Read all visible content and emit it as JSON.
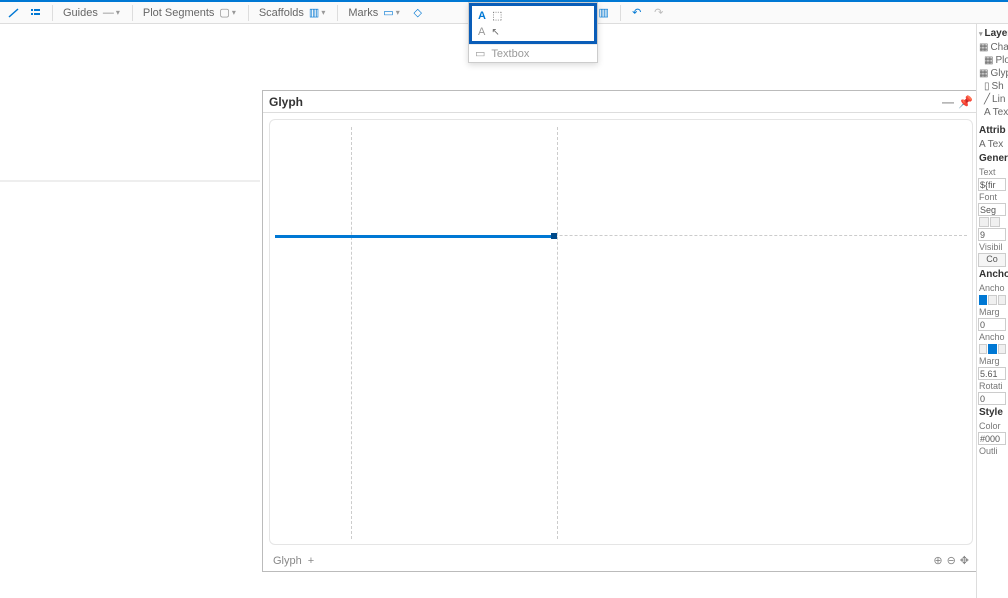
{
  "toolbar": {
    "guides": "Guides",
    "plotSegments": "Plot Segments",
    "scaffolds": "Scaffolds",
    "marks": "Marks"
  },
  "popup": {
    "item1": "Text",
    "item2": "Text",
    "textbox": "Textbox"
  },
  "glyph": {
    "title": "Glyph",
    "footer": "Glyph",
    "plus": "+"
  },
  "right": {
    "layers": "Layers",
    "chart": "Chart",
    "plot": "Plo",
    "glyph": "Glyph",
    "sh": "Sh",
    "lin": "Lin",
    "text": "Tex",
    "attrib": "Attrib",
    "attribText": "Tex",
    "general": "Gener",
    "textLabel": "Text",
    "textVal": "${fir",
    "font": "Font",
    "fontVal": "Seg",
    "sizeVal": "9",
    "visibility": "Visibil",
    "co": "Co",
    "anchor1": "Ancho",
    "anchor2": "Ancho",
    "margin1": "Marg",
    "margin1Val": "0",
    "anchor3": "Ancho",
    "margin2": "Marg",
    "margin2Val": "5.61",
    "rotation": "Rotati",
    "rotationVal": "0",
    "style": "Style",
    "color": "Color",
    "colorVal": "#000",
    "outline": "Outli"
  }
}
